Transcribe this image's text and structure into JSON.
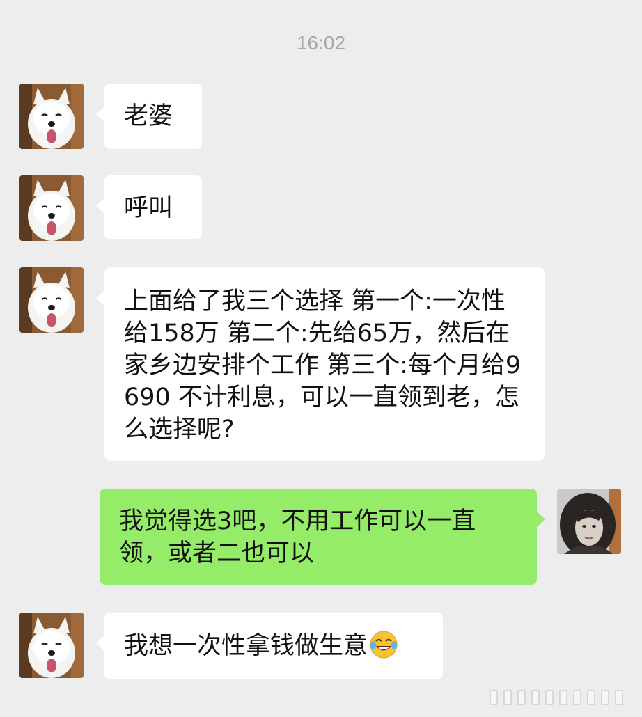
{
  "chat": {
    "timestamp": "16:02",
    "messages": [
      {
        "sender": "other",
        "text": "老婆"
      },
      {
        "sender": "other",
        "text": "呼叫"
      },
      {
        "sender": "other",
        "text": "上面给了我三个选择 第一个:一次性给158万 第二个:先给65万，然后在家乡边安排个工作 第三个:每个月给9690 不计利息，可以一直领到老，怎么选择呢?"
      },
      {
        "sender": "self",
        "text": "我觉得选3吧，不用工作可以一直领，或者二也可以"
      },
      {
        "sender": "other",
        "text": "我想一次性拿钱做生意",
        "emoji": "crying-laughing-emoji"
      }
    ]
  },
  "colors": {
    "background": "#ededed",
    "incoming_bubble": "#ffffff",
    "outgoing_bubble": "#95ec69",
    "timestamp": "#a8a8a8"
  },
  "icons": {
    "other_avatar": "samoyed-dog-avatar",
    "self_avatar": "woman-portrait-avatar",
    "watermark": "barcode-watermark-icon"
  }
}
